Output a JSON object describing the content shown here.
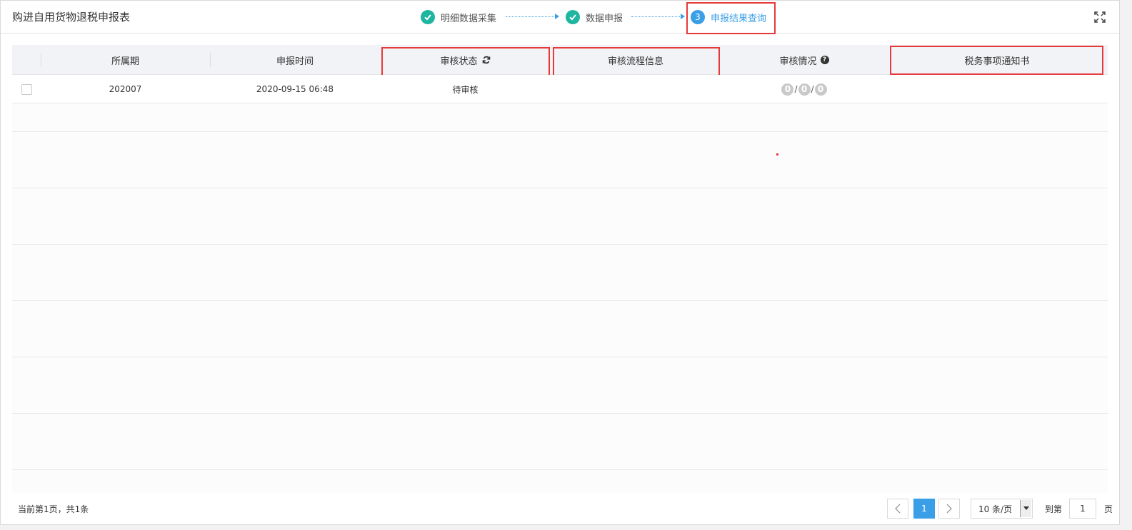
{
  "header": {
    "title": "购进自用货物退税申报表",
    "steps": [
      {
        "number": "1",
        "label": "明细数据采集",
        "state": "done"
      },
      {
        "number": "2",
        "label": "数据申报",
        "state": "done"
      },
      {
        "number": "3",
        "label": "申报结果查询",
        "state": "active"
      }
    ],
    "expand_icon": "fullscreen-icon"
  },
  "table": {
    "columns": [
      {
        "label": "所属期"
      },
      {
        "label": "申报时间"
      },
      {
        "label": "审核状态",
        "icon": "refresh-icon"
      },
      {
        "label": "审核流程信息"
      },
      {
        "label": "审核情况",
        "icon": "question-icon"
      },
      {
        "label": "税务事项通知书"
      }
    ],
    "rows": [
      {
        "period": "202007",
        "report_time": "2020-09-15 06:48",
        "status": "待审核",
        "process_info": "",
        "review_counts": [
          "0",
          "0",
          "0"
        ],
        "review_separator": "/",
        "notice": ""
      }
    ]
  },
  "footer": {
    "info": "当前第1页，共1条",
    "current_page": "1",
    "prev_icon": "chevron-left-icon",
    "next_icon": "chevron-right-icon",
    "page_size": "10 条/页",
    "goto_label": "到第",
    "goto_value": "1",
    "goto_suffix": "页"
  },
  "colors": {
    "accent": "#3a9fe7",
    "done": "#1fb5a0",
    "highlight": "#e63a3a"
  }
}
